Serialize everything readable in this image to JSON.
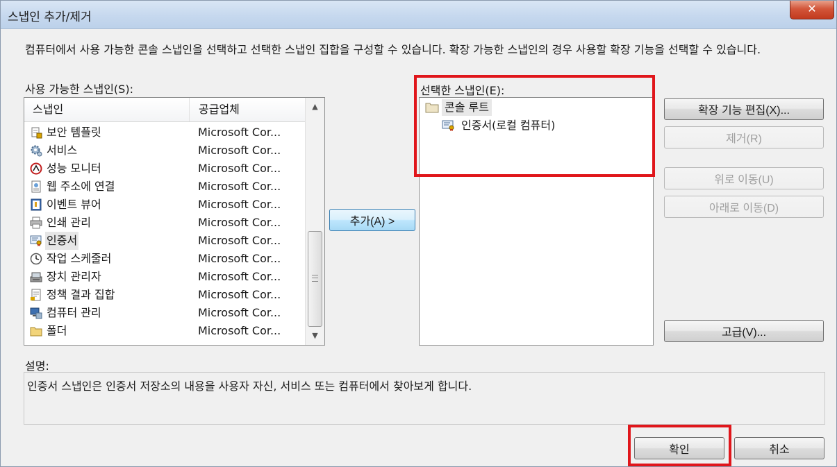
{
  "window": {
    "title": "스냅인 추가/제거",
    "close_glyph": "✕"
  },
  "description": "컴퓨터에서 사용 가능한 콘솔 스냅인을 선택하고 선택한 스냅인 집합을 구성할 수 있습니다. 확장 가능한 스냅인의 경우 사용할 확장 기능을 선택할 수 있습니다.",
  "available": {
    "label": "사용 가능한 스냅인(S):",
    "columns": [
      "스냅인",
      "공급업체"
    ],
    "items": [
      {
        "name": "보안 템플릿",
        "vendor": "Microsoft Cor...",
        "icon": "security-template-icon"
      },
      {
        "name": "서비스",
        "vendor": "Microsoft Cor...",
        "icon": "services-gear-icon"
      },
      {
        "name": "성능 모니터",
        "vendor": "Microsoft Cor...",
        "icon": "performance-monitor-icon"
      },
      {
        "name": "웹 주소에 연결",
        "vendor": "Microsoft Cor...",
        "icon": "web-link-icon"
      },
      {
        "name": "이벤트 뷰어",
        "vendor": "Microsoft Cor...",
        "icon": "event-viewer-icon"
      },
      {
        "name": "인쇄 관리",
        "vendor": "Microsoft Cor...",
        "icon": "printer-icon"
      },
      {
        "name": "인증서",
        "vendor": "Microsoft Cor...",
        "icon": "certificate-icon",
        "selected": true
      },
      {
        "name": "작업 스케줄러",
        "vendor": "Microsoft Cor...",
        "icon": "clock-icon"
      },
      {
        "name": "장치 관리자",
        "vendor": "Microsoft Cor...",
        "icon": "device-manager-icon"
      },
      {
        "name": "정책 결과 집합",
        "vendor": "Microsoft Cor...",
        "icon": "policy-icon"
      },
      {
        "name": "컴퓨터 관리",
        "vendor": "Microsoft Cor...",
        "icon": "computer-management-icon"
      },
      {
        "name": "폴더",
        "vendor": "Microsoft Cor...",
        "icon": "folder-icon"
      }
    ]
  },
  "add_button": "추가(A) >",
  "selected": {
    "label": "선택한 스냅인(E):",
    "root": "콘솔 루트",
    "child": "인증서(로컬 컴퓨터)"
  },
  "side_buttons": {
    "edit_extensions": "확장 기능 편집(X)...",
    "remove": "제거(R)",
    "move_up": "위로 이동(U)",
    "move_down": "아래로 이동(D)",
    "advanced": "고급(V)..."
  },
  "details": {
    "label": "설명:",
    "text": "인증서 스냅인은 인증서 저장소의 내용을 사용자 자신, 서비스 또는 컴퓨터에서 찾아보게 합니다."
  },
  "footer": {
    "ok": "확인",
    "cancel": "취소"
  },
  "colors": {
    "highlight": "#e0161b",
    "focus_border": "#3c7fb1"
  }
}
